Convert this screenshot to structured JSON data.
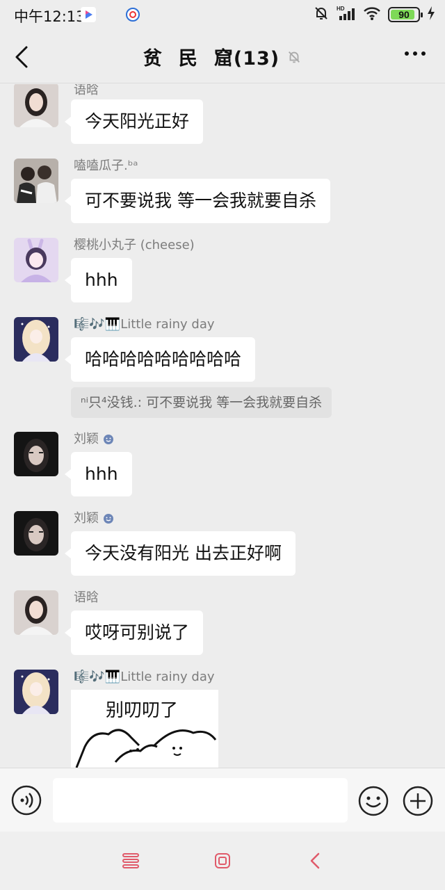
{
  "status_bar": {
    "time": "中午12:13",
    "battery": "90",
    "battery_level": 0.9,
    "network": "HD"
  },
  "header": {
    "title_a": "贫",
    "title_b": "民",
    "title_c": "窟(13)"
  },
  "messages": [
    {
      "sender": "语晗",
      "text": "今天阳光正好",
      "avatar": "girl-photo-avatar"
    },
    {
      "sender": "嗑嗑瓜子.ᵇᵃ",
      "text": "可不要说我 等一会我就要自杀",
      "avatar": "couple-photo-avatar"
    },
    {
      "sender": "樱桃小丸子 (cheese)",
      "text": "hhh",
      "avatar": "anime-purple-avatar"
    },
    {
      "sender": "🎼🎶🎹Little rainy day",
      "text": "哈哈哈哈哈哈哈哈哈",
      "quote": "ⁿⁱ只⁴没钱.: 可不要说我 等一会我就要自杀",
      "avatar": "anime-night-avatar"
    },
    {
      "sender": "刘颖",
      "text": "hhh",
      "avatar": "dark-selfie-avatar"
    },
    {
      "sender": "刘颖",
      "text": "今天没有阳光 出去正好啊",
      "avatar": "dark-selfie-avatar"
    },
    {
      "sender": "语晗",
      "text": "哎呀可别说了",
      "avatar": "girl-photo-avatar"
    },
    {
      "sender": "🎼🎶🎹Little rainy day",
      "sticker_text": "别叨叨了",
      "avatar": "anime-night-avatar"
    }
  ],
  "input": {
    "placeholder": ""
  },
  "colors": {
    "background": "#ededed",
    "bubble": "#ffffff",
    "quote_bg": "#e2e2e2",
    "nav_accent": "#e05a6a"
  }
}
